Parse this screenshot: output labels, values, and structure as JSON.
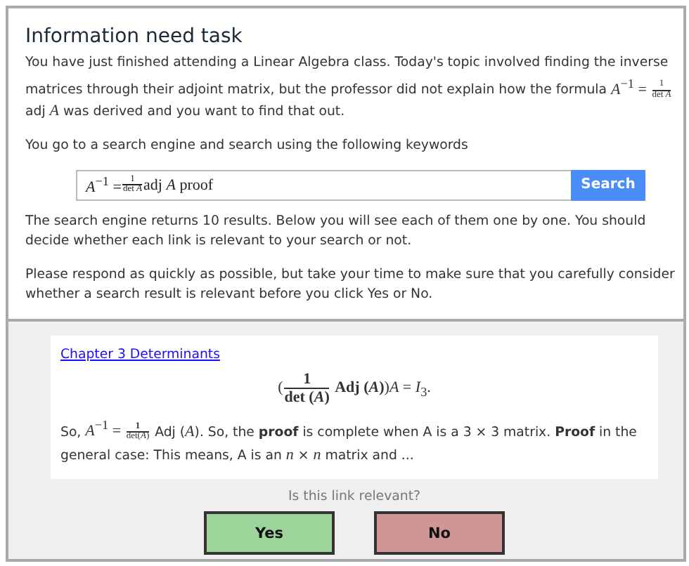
{
  "task": {
    "title": "Information need task",
    "description": [
      {
        "kind": "text",
        "text": "You have just finished attending a Linear Algebra class. Today's topic involved finding the inverse matrices through their adjoint matrix, but the professor did not explain how the formula "
      },
      {
        "kind": "math",
        "text": "*A*$^{−1}$ = "
      },
      {
        "kind": "frac",
        "num": "1",
        "den": "det *A*"
      },
      {
        "kind": "text",
        "text": " adj "
      },
      {
        "kind": "math",
        "text": "*A*"
      },
      {
        "kind": "text",
        "text": " was derived and you want to find that out."
      }
    ],
    "search_intro": "You go to a search engine and search using the following keywords",
    "query": [
      {
        "kind": "math",
        "text": "*A*$^{−1}$ = "
      },
      {
        "kind": "frac",
        "num": "1",
        "den": "det *A*"
      },
      {
        "kind": "math",
        "text": " adj *A* proof"
      }
    ],
    "search_button": "Search",
    "results_note": "The search engine returns 10 results. Below you will see each of them one by one. You should decide whether each link is relevant to your search or not.",
    "instructions": "Please respond as quickly as possible, but take your time to make sure that you carefully consider whether a search result is relevant before you click Yes or No."
  },
  "result": {
    "link": "Chapter 3 Determinants",
    "formula": [
      {
        "kind": "math",
        "text": "("
      },
      {
        "kind": "frac",
        "num": "**1**",
        "den": "**det (*A*)**"
      },
      {
        "kind": "math",
        "text": " **Adj (*A*)**)*A* = *I*$_{3}$."
      }
    ],
    "snippet": [
      {
        "kind": "text",
        "text": "So, "
      },
      {
        "kind": "math",
        "text": "*A*$^{−1}$ = "
      },
      {
        "kind": "frac",
        "num": "**1**",
        "den": "det(*A*)"
      },
      {
        "kind": "text",
        "text": " Adj ("
      },
      {
        "kind": "math",
        "text": "*A*"
      },
      {
        "kind": "text",
        "text": "). So, the **proof** is complete when A is a 3 × 3 matrix. **Proof** in the general case: This means, A is an "
      },
      {
        "kind": "math",
        "text": "*n*"
      },
      {
        "kind": "text",
        "text": " × "
      },
      {
        "kind": "math",
        "text": "*n*"
      },
      {
        "kind": "text",
        "text": " matrix and ..."
      }
    ]
  },
  "question": "Is this link relevant?",
  "answers": [
    {
      "label": "Yes",
      "kind": "yes"
    },
    {
      "label": "No",
      "kind": "no"
    }
  ]
}
